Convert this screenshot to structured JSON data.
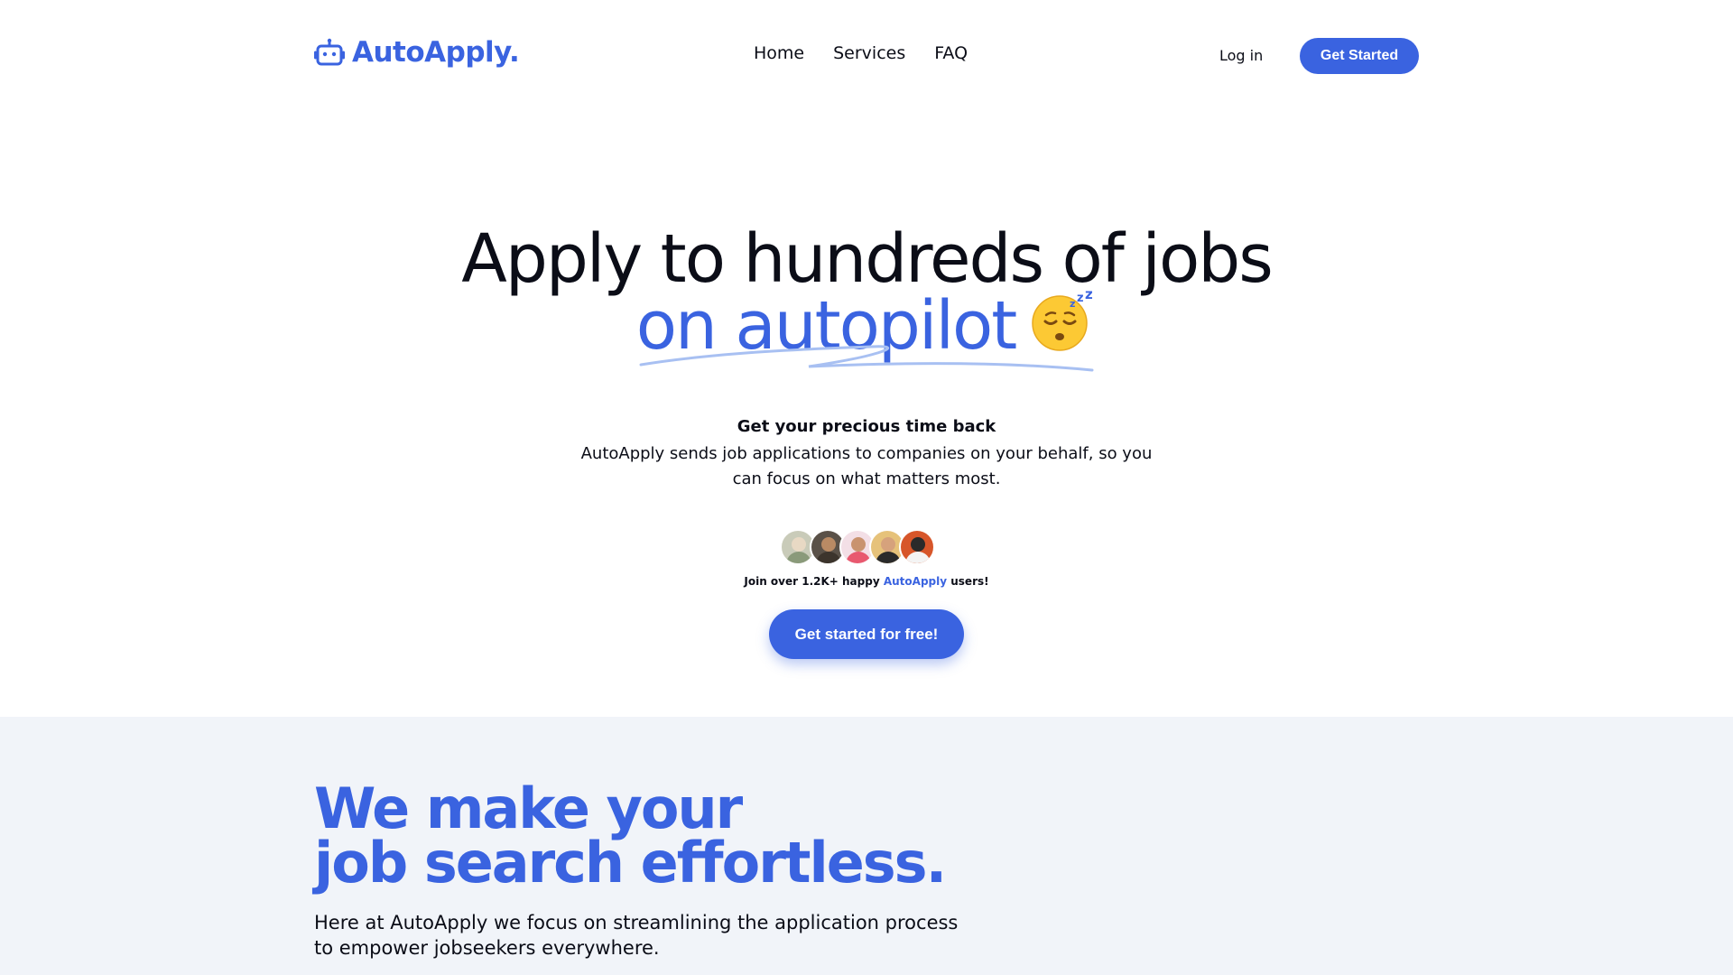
{
  "brand": {
    "name": "AutoApply.",
    "accent_color": "#3a63e0"
  },
  "nav": {
    "items": [
      {
        "label": "Home"
      },
      {
        "label": "Services"
      },
      {
        "label": "FAQ"
      }
    ],
    "login_label": "Log in",
    "cta_label": "Get Started"
  },
  "hero": {
    "headline_line1": "Apply to hundreds of jobs",
    "headline_line2": "on autopilot",
    "emoji": "sleeping-face-emoji",
    "subtitle": "Get your precious time back",
    "description": "AutoApply sends job applications to companies on your behalf, so you can focus on what matters most.",
    "social_proof": {
      "prefix": "Join over 1.2K+ happy",
      "brand": "AutoApply",
      "suffix": "users!"
    },
    "cta_label": "Get started for free!"
  },
  "section2": {
    "title_line1": "We make your",
    "title_line2": "job search effortless.",
    "text": "Here at AutoApply we focus on streamlining the application process to empower jobseekers everywhere."
  },
  "colors": {
    "primary": "#3a63e0",
    "text": "#0b0d17",
    "section_bg": "#f1f4f9"
  }
}
